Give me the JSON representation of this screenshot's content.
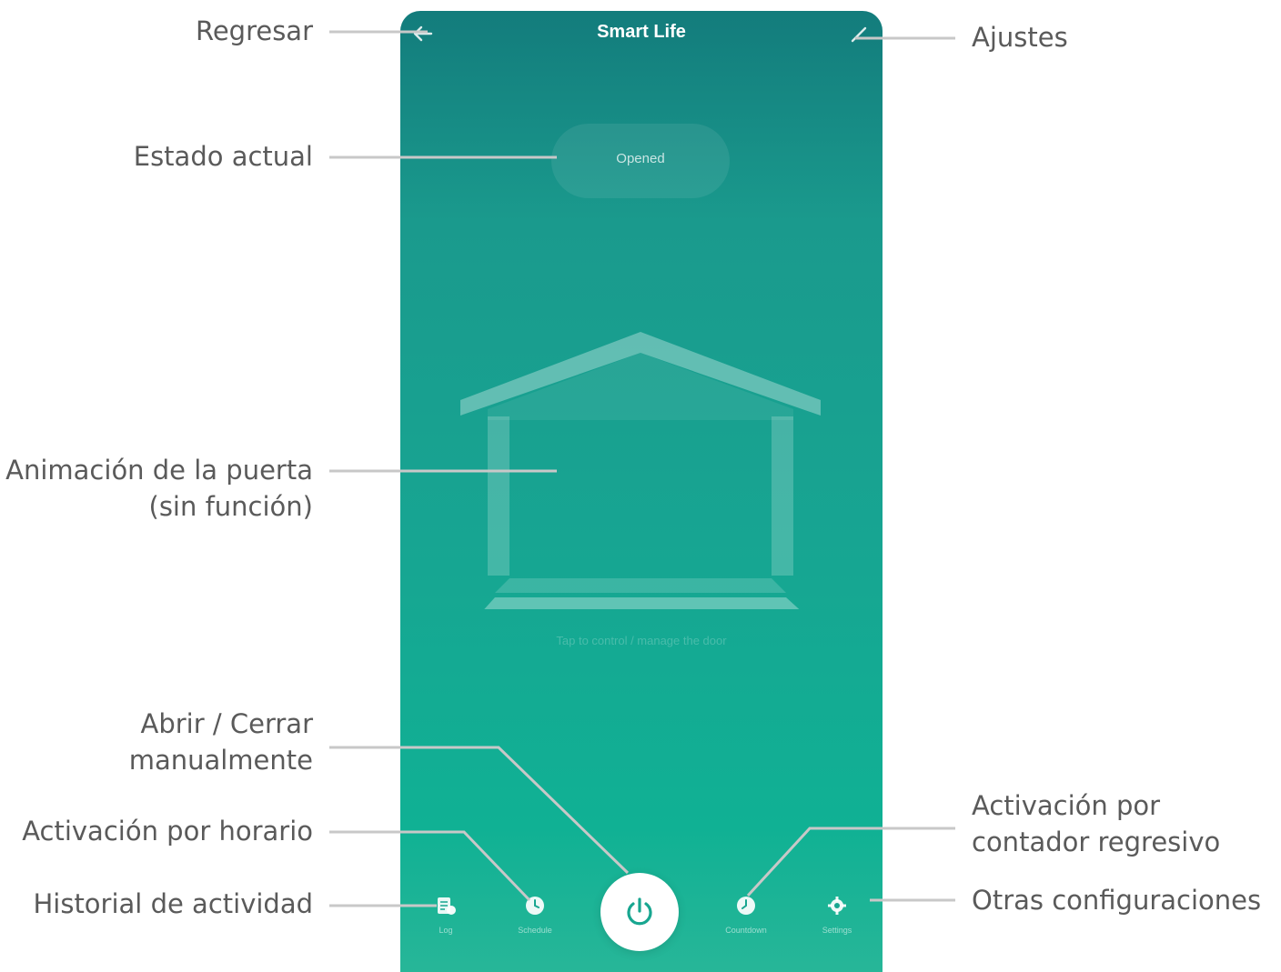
{
  "app": {
    "title": "Smart Life"
  },
  "status": {
    "text": "Opened"
  },
  "door": {
    "hint": "Tap to control / manage the door"
  },
  "bottom_nav": [
    {
      "label": "Log",
      "icon": "log-icon"
    },
    {
      "label": "Schedule",
      "icon": "clock-icon"
    },
    {
      "label": "Countdown",
      "icon": "timer-icon"
    },
    {
      "label": "Settings",
      "icon": "gear-icon"
    }
  ],
  "callouts": {
    "back": "Regresar",
    "settings": "Ajustes",
    "current_state": "Estado actual",
    "door_animation_line1": "Animación de la puerta",
    "door_animation_line2": "(sin función)",
    "manual_line1": "Abrir / Cerrar",
    "manual_line2": "manualmente",
    "schedule": "Activación por horario",
    "history": "Historial de actividad",
    "countdown_line1": "Activación por",
    "countdown_line2": "contador regresivo",
    "other": "Otras configuraciones"
  },
  "colors": {
    "teal_top": "#137c7c",
    "teal_bottom": "#10b194",
    "callout_text": "#5a5a5a",
    "leader_line": "#c8c8c8"
  }
}
